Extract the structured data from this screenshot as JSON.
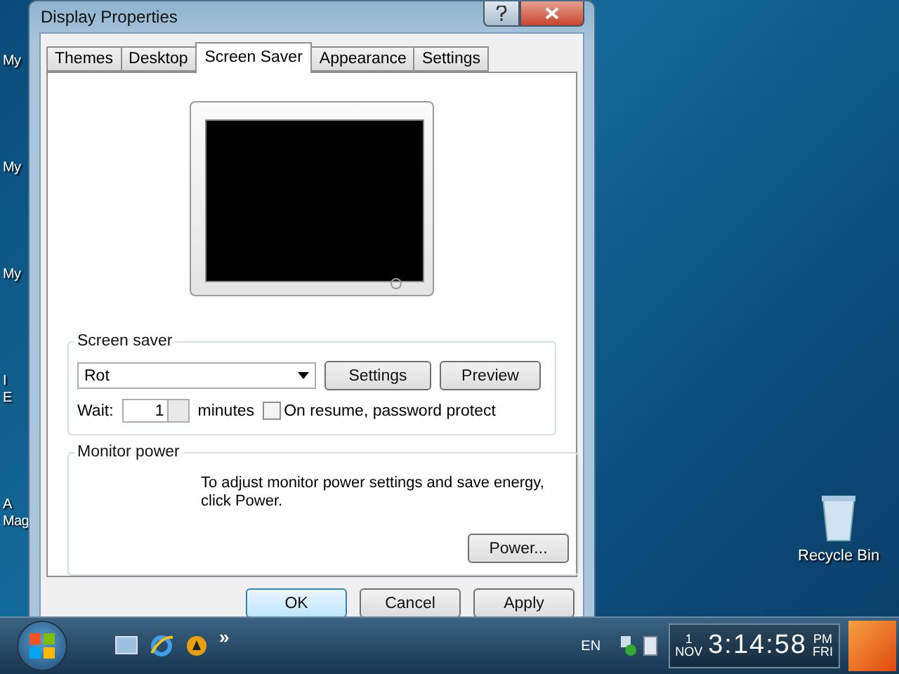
{
  "desktop_icons": [
    {
      "lines": [
        "My"
      ]
    },
    {
      "lines": [
        "My"
      ]
    },
    {
      "lines": [
        "My"
      ]
    },
    {
      "lines": [
        "I",
        "E"
      ]
    },
    {
      "lines": [
        "A",
        "Mag"
      ]
    }
  ],
  "recycle_bin": {
    "label": "Recycle Bin"
  },
  "window": {
    "title": "Display Properties"
  },
  "tabs": [
    {
      "label": "Themes",
      "selected": false
    },
    {
      "label": "Desktop",
      "selected": false
    },
    {
      "label": "Screen Saver",
      "selected": true
    },
    {
      "label": "Appearance",
      "selected": false
    },
    {
      "label": "Settings",
      "selected": false
    }
  ],
  "screen_saver": {
    "legend": "Screen saver",
    "value": "Rot",
    "settings_button": "Settings",
    "preview_button": "Preview",
    "wait_label": "Wait:",
    "wait_value": "1",
    "minutes_label": "minutes",
    "password_protect": {
      "label": "On resume, password protect",
      "checked": false
    }
  },
  "monitor_power": {
    "legend": "Monitor power",
    "text": "To adjust monitor power settings and save energy, click Power.",
    "button": "Power..."
  },
  "buttons": [
    {
      "label": "OK",
      "selected": true
    },
    {
      "label": "Cancel",
      "selected": false
    },
    {
      "label": "Apply",
      "selected": false
    }
  ],
  "taskbar": {
    "chevron": "»",
    "language": "EN",
    "clock": {
      "day": "1",
      "month": "NOV",
      "time": "3:14:58",
      "ampm": "PM",
      "weekday": "FRI"
    }
  }
}
